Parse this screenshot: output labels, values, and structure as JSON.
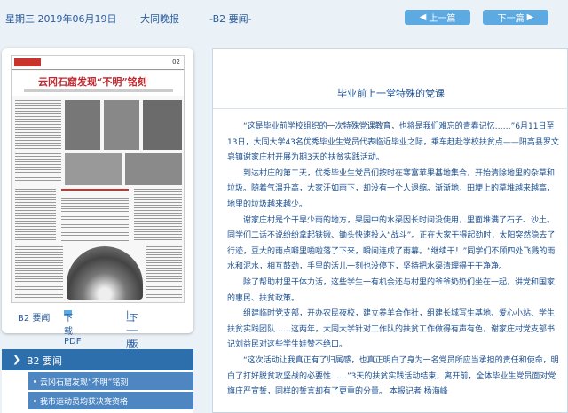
{
  "topbar": {
    "date": "星期三 2019年06月19日",
    "paper_name": "大同晚报",
    "page_label": "-B2 要闻-",
    "prev_label": "上一篇",
    "next_label": "下一篇",
    "prev_icon": "chevron-left-icon",
    "next_icon": "chevron-right-icon"
  },
  "thumbnail": {
    "headline": "云冈石窟发现“不明”铭刻",
    "page_no": "02",
    "page_link": "B2 要闻",
    "download_pdf": "下载PDF",
    "prev_page": "上一版",
    "next_page": "下一版"
  },
  "section": {
    "title": "B2 要闻",
    "items": [
      {
        "label": "云冈石窟发现“不明”铭刻"
      },
      {
        "label": "我市运动员均获决赛资格"
      }
    ]
  },
  "article": {
    "title": "毕业前上一堂特殊的党课",
    "paragraphs": [
      "“这是毕业前学校组织的一次特殊党课教育，也将是我们难忘的青春记忆……”6月11日至13日，大同大学43名优秀毕业生党员代表临近毕业之际，乘车赶赴学校扶贫点——阳高县罗文皂镇谢家庄村开展为期3天的扶贫实践活动。",
      "到达村庄的第二天，优秀毕业生党员们按时在寒富苹果基地集合，开始清除地里的杂草和垃圾。随着气温升高，大家汗如雨下，却没有一个人退缩。渐渐地，田埂上的草堆越来越高，地里的垃圾越来越少。",
      "谢家庄村是个干旱少雨的地方，果园中的水渠因长时间没使用，里面堆满了石子、沙土。同学们二话不说纷纷拿起铁锹、锄头快速投入“战斗”。正在大家干得起劲时，太阳突然隐去了行迹，豆大的雨点噼里啪啦落了下来，瞬间连成了雨幕。“继续干！”同学们不顾四处飞溅的雨水和泥水，相互鼓劲，手里的活儿一刻也没停下，坚持把水渠清理得干干净净。",
      "除了帮助村里干体力活，这些学生一有机会还与村里的爷爷奶奶们坐在一起，讲党和国家的惠民、扶贫政策。",
      "组建临时党支部，开办农民夜校，建立养羊合作社，组建长城写生基地、爱心小站、学生扶贫实践团队……这两年，大同大学针对工作队的扶贫工作做得有声有色，谢家庄村党支部书记刘益民对这些学生娃赞不绝口。",
      "“这次活动让我真正有了归属感，也真正明白了身为一名党员所应当承担的责任和使命，明白了打好脱贫攻坚战的必要性……”3天的扶贫实践活动结束，离开前，全体毕业生党员面对党旗庄严宣誓，同样的誓言却有了更重的分量。    本报记者 杨海峰"
    ]
  }
}
